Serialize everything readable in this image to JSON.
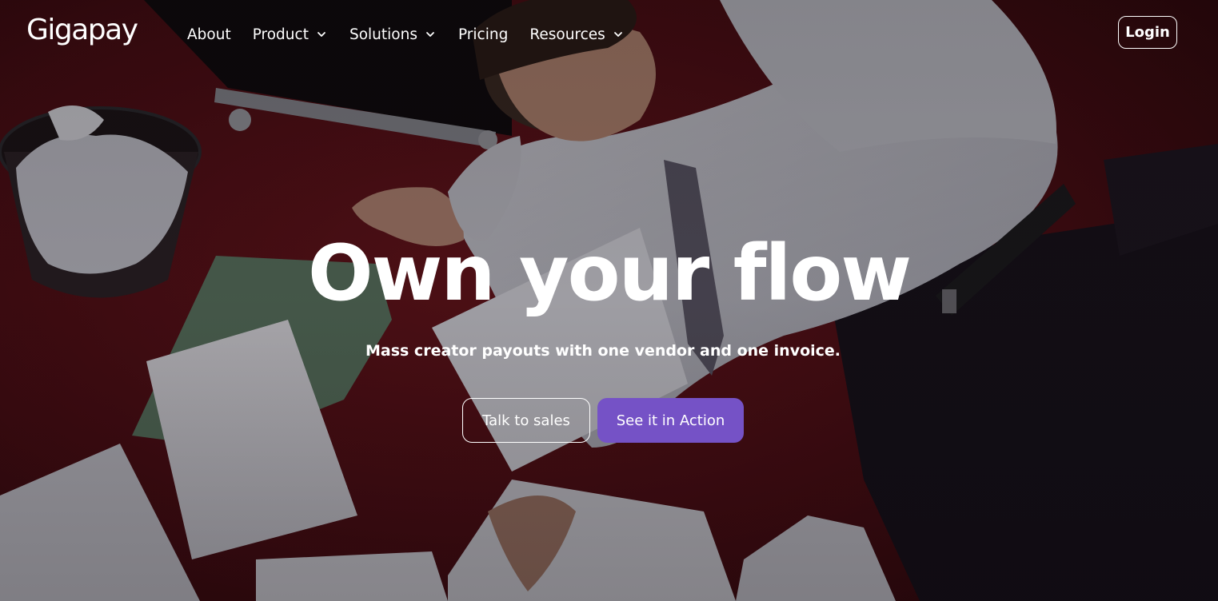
{
  "brand": {
    "logo_text": "Gigapay"
  },
  "nav": {
    "items": [
      {
        "label": "About",
        "has_dropdown": false
      },
      {
        "label": "Product",
        "has_dropdown": true
      },
      {
        "label": "Solutions",
        "has_dropdown": true
      },
      {
        "label": "Pricing",
        "has_dropdown": false
      },
      {
        "label": "Resources",
        "has_dropdown": true
      }
    ],
    "login_label": "Login"
  },
  "hero": {
    "headline": "Own your flow",
    "subheadline": "Mass creator payouts with one vendor and one invoice.",
    "secondary_cta": "Talk to sales",
    "primary_cta": "See it in Action"
  },
  "colors": {
    "primary_button": "#7552c6",
    "background_carpet": "#4a0e12",
    "text": "#ffffff"
  },
  "icons": {
    "dropdown": "chevron-down-icon"
  }
}
